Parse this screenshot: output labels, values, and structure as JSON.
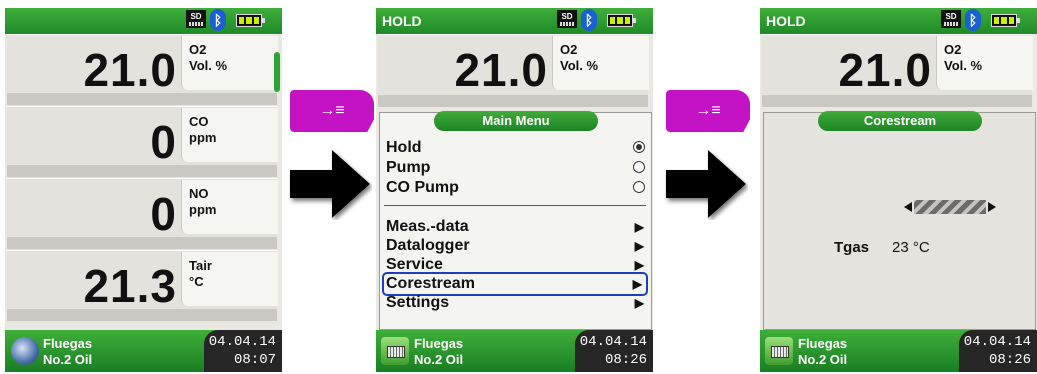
{
  "screens": [
    {
      "status": {
        "hold": "",
        "sd": "SD"
      },
      "tiles": [
        {
          "value": "21.0",
          "unit1": "O2",
          "unit2": "Vol. %"
        },
        {
          "value": "0",
          "unit1": "CO",
          "unit2": "ppm"
        },
        {
          "value": "0",
          "unit1": "NO",
          "unit2": "ppm"
        },
        {
          "value": "21.3",
          "unit1": "Tair",
          "unit2": "°C"
        }
      ],
      "footer": {
        "line1": "Fluegas",
        "line2": "No.2 Oil",
        "date": "04.04.14",
        "time": "08:07"
      }
    },
    {
      "status": {
        "hold": "HOLD",
        "sd": "SD"
      },
      "tile": {
        "value": "21.0",
        "unit1": "O2",
        "unit2": "Vol. %"
      },
      "menu": {
        "title": "Main Menu",
        "radio_items": [
          {
            "label": "Hold",
            "selected": true
          },
          {
            "label": "Pump",
            "selected": false
          },
          {
            "label": "CO Pump",
            "selected": false
          }
        ],
        "nav_items": [
          "Meas.-data",
          "Datalogger",
          "Service",
          "Corestream",
          "Settings"
        ],
        "highlighted": "Corestream"
      },
      "footer": {
        "line1": "Fluegas",
        "line2": "No.2 Oil",
        "date": "04.04.14",
        "time": "08:26"
      }
    },
    {
      "status": {
        "hold": "HOLD",
        "sd": "SD"
      },
      "tile": {
        "value": "21.0",
        "unit1": "O2",
        "unit2": "Vol. %"
      },
      "corestream": {
        "title": "Corestream",
        "label": "Tgas",
        "value": "23 °C"
      },
      "footer": {
        "line1": "Fluegas",
        "line2": "No.2 Oil",
        "date": "04.04.14",
        "time": "08:26"
      }
    }
  ],
  "key_symbol": "→≡",
  "colors": {
    "accent_green": "#2da333",
    "key_magenta": "#c412c5",
    "highlight_blue": "#1d3fbf"
  }
}
